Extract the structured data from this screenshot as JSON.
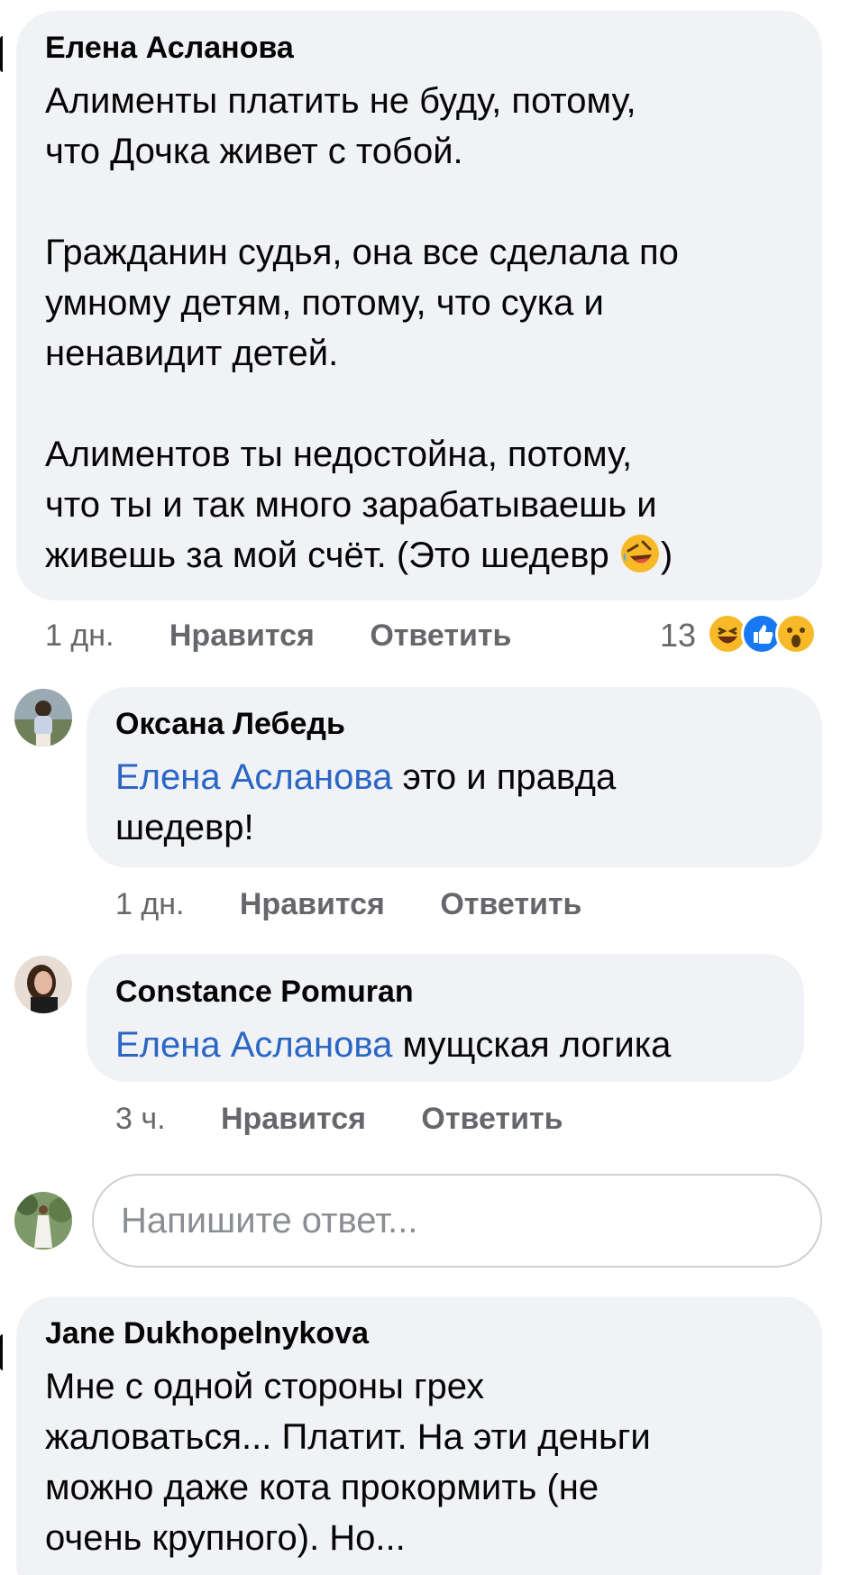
{
  "comments": [
    {
      "author": "Елена Асланова",
      "lines": [
        "Алименты платить не буду, потому,",
        "что Дочка живет с тобой.",
        "",
        "Гражданин судья, она все сделала по",
        "умному детям, потому, что сука и",
        "ненавидит детей.",
        "",
        "Алиментов ты недостойна, потому,",
        "что ты и так много зарабатываешь и",
        "живешь за мой счёт. (Это шедевр"
      ],
      "closing": ")",
      "time": "1 дн.",
      "like": "Нравится",
      "reply": "Ответить",
      "reaction_count": "13",
      "reactions": [
        "haha-icon",
        "like-icon",
        "wow-icon"
      ]
    },
    {
      "author": "Оксана Лебедь",
      "mention": "Елена Асланова",
      "text_line1": " это и правда",
      "text_line2": "шедевр!",
      "time": "1 дн.",
      "like": "Нравится",
      "reply": "Ответить"
    },
    {
      "author": "Constance  Pomuran",
      "mention": "Елена Асланова",
      "text": " мущская логика",
      "time": "3 ч.",
      "like": "Нравится",
      "reply": "Ответить"
    },
    {
      "author": "Jane Dukhopelnykova",
      "lines": [
        "Мне с одной стороны грех",
        "жаловаться... Платит. На эти деньги",
        "можно даже кота прокормить (не",
        "очень крупного). Но..."
      ]
    }
  ],
  "reply_box": {
    "placeholder": "Напишите ответ..."
  },
  "colors": {
    "bubble": "#f0f2f5",
    "mention": "#2a66c4",
    "meta": "#65676b",
    "like_blue": "#1877f2",
    "reaction_yellow": "#f7b928"
  }
}
